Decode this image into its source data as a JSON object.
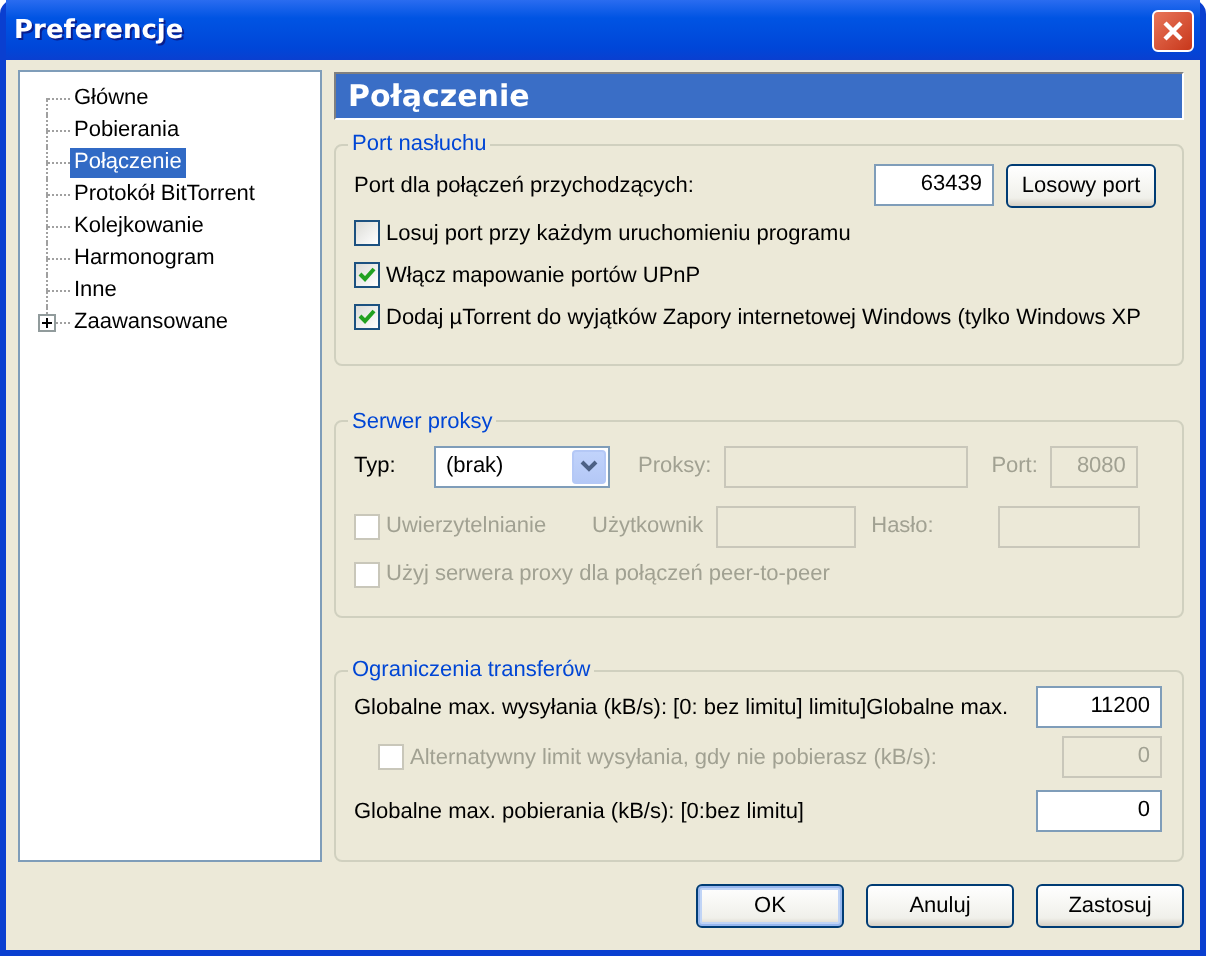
{
  "window": {
    "title": "Preferencje"
  },
  "sidebar": {
    "items": [
      {
        "label": "Główne",
        "selected": false
      },
      {
        "label": "Pobierania",
        "selected": false
      },
      {
        "label": "Połączenie",
        "selected": true
      },
      {
        "label": "Protokół BitTorrent",
        "selected": false
      },
      {
        "label": "Kolejkowanie",
        "selected": false
      },
      {
        "label": "Harmonogram",
        "selected": false
      },
      {
        "label": "Inne",
        "selected": false
      },
      {
        "label": "Zaawansowane",
        "selected": false,
        "expanded": false
      }
    ]
  },
  "header": {
    "title": "Połączenie"
  },
  "port_group": {
    "title": "Port nasłuchu",
    "port_label": "Port dla połączeń przychodzących:",
    "port_value": "63439",
    "random_button": "Losowy port",
    "options": [
      {
        "label": "Losuj port przy każdym uruchomieniu programu",
        "checked": false
      },
      {
        "label": "Włącz mapowanie portów UPnP",
        "checked": true
      },
      {
        "label": "Dodaj µTorrent do wyjątków Zapory internetowej Windows (tylko Windows XP",
        "checked": true
      }
    ]
  },
  "proxy_group": {
    "title": "Serwer proksy",
    "type_label": "Typ:",
    "type_value": "(brak)",
    "proxy": {
      "label": "Proksy:",
      "disabled": true
    },
    "port": {
      "label": "Port:",
      "value": "8080",
      "disabled": true
    },
    "auth": {
      "label": "Uwierzytelnianie",
      "checked": false,
      "disabled": true
    },
    "user": {
      "label": "Użytkownik",
      "disabled": true
    },
    "password": {
      "label": "Hasło:",
      "disabled": true
    },
    "p2p": {
      "label": "Użyj serwera proxy dla połączeń peer-to-peer",
      "checked": false,
      "disabled": true
    }
  },
  "limits_group": {
    "title": "Ograniczenia transferów",
    "upload": {
      "label": "Globalne max. wysyłania (kB/s): [0: bez limitu] limitu]Globalne max.",
      "value": "11200"
    },
    "alt": {
      "label": "Alternatywny limit wysyłania, gdy nie pobierasz (kB/s):",
      "checked": false,
      "value": "0",
      "disabled": true
    },
    "download": {
      "label": "Globalne max. pobierania (kB/s): [0:bez limitu]",
      "value": "0"
    }
  },
  "buttons": [
    {
      "label": "OK",
      "default": true
    },
    {
      "label": "Anuluj",
      "default": false
    },
    {
      "label": "Zastosuj",
      "default": false
    }
  ]
}
